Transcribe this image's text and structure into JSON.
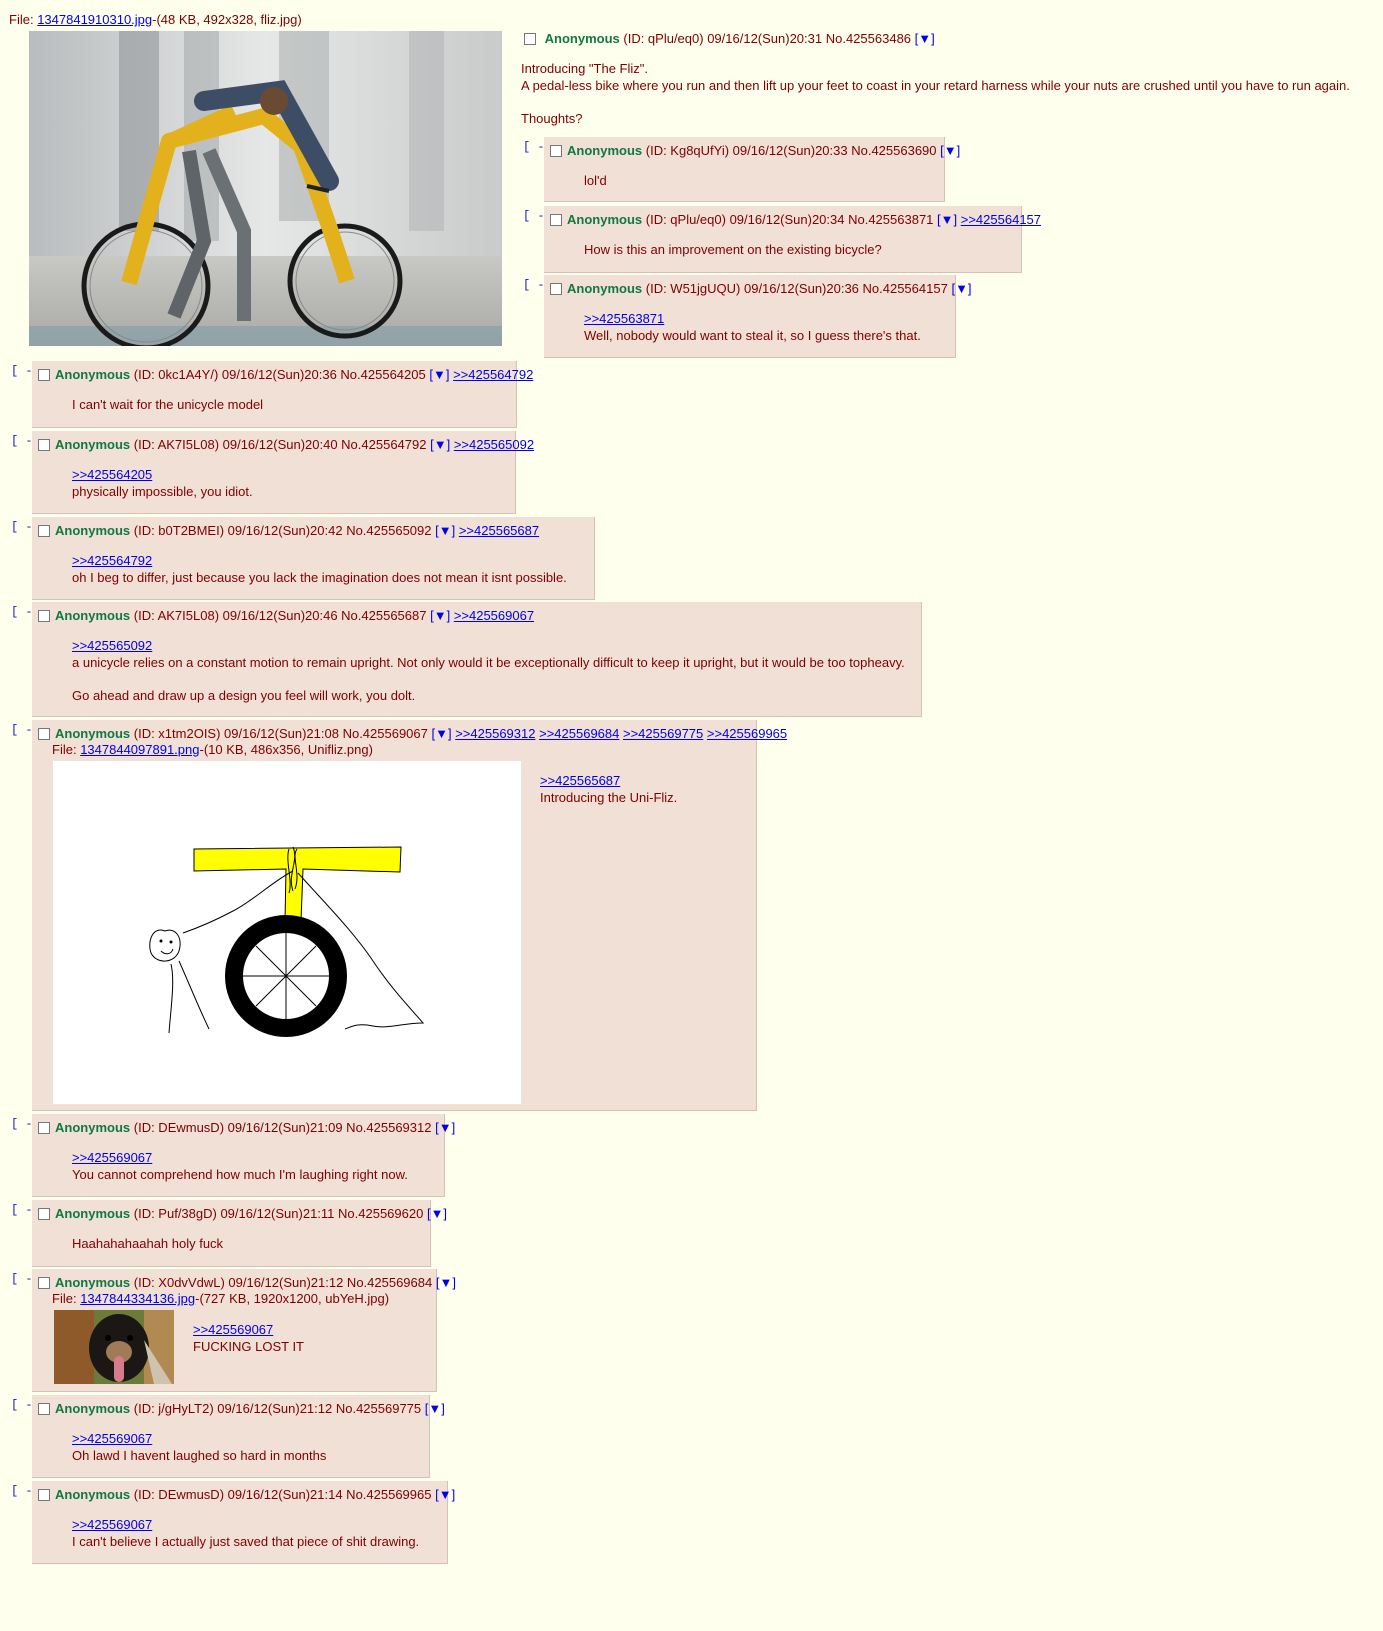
{
  "op": {
    "file_label": "File:",
    "file_link": "1347841910310.jpg",
    "file_meta": "-(48 KB, 492x328, fliz.jpg)",
    "name": "Anonymous",
    "info": "(ID: qPlu/eq0) 09/16/12(Sun)20:31 No.425563486",
    "arrow": "[▼]",
    "lines": [
      "Introducing \"The Fliz\".",
      "A pedal-less bike where you run and then lift up your feet to coast in your retard harness while your nuts are crushed until you have to run again.",
      "",
      "Thoughts?"
    ]
  },
  "collapse_label": "[ - ]",
  "replies": [
    {
      "name": "Anonymous",
      "info": "(ID: Kg8qUfYi) 09/16/12(Sun)20:33 No.425563690",
      "arrow": "[▼]",
      "backlinks": [],
      "quotes": [],
      "lines": [
        "lol'd"
      ]
    },
    {
      "name": "Anonymous",
      "info": "(ID: qPlu/eq0) 09/16/12(Sun)20:34 No.425563871",
      "arrow": "[▼]",
      "backlinks": [
        ">>425564157"
      ],
      "quotes": [],
      "lines": [
        "How is this an improvement on the existing bicycle?"
      ]
    },
    {
      "name": "Anonymous",
      "info": "(ID: W51jgUQU) 09/16/12(Sun)20:36 No.425564157",
      "arrow": "[▼]",
      "backlinks": [],
      "quotes": [
        ">>425563871"
      ],
      "lines": [
        "Well, nobody would want to steal it, so I guess there's that."
      ]
    },
    {
      "name": "Anonymous",
      "info": "(ID: 0kc1A4Y/) 09/16/12(Sun)20:36 No.425564205",
      "arrow": "[▼]",
      "backlinks": [
        ">>425564792"
      ],
      "quotes": [],
      "lines": [
        "I can't wait for the unicycle model"
      ]
    },
    {
      "name": "Anonymous",
      "info": "(ID: AK7I5L08) 09/16/12(Sun)20:40 No.425564792",
      "arrow": "[▼]",
      "backlinks": [
        ">>425565092"
      ],
      "quotes": [
        ">>425564205"
      ],
      "lines": [
        "physically impossible, you idiot."
      ]
    },
    {
      "name": "Anonymous",
      "info": "(ID: b0T2BMEI) 09/16/12(Sun)20:42 No.425565092",
      "arrow": "[▼]",
      "backlinks": [
        ">>425565687"
      ],
      "quotes": [
        ">>425564792"
      ],
      "lines": [
        "oh I beg to differ, just because you lack the imagination does not mean it isnt possible."
      ]
    },
    {
      "name": "Anonymous",
      "info": "(ID: AK7I5L08) 09/16/12(Sun)20:46 No.425565687",
      "arrow": "[▼]",
      "backlinks": [
        ">>425569067"
      ],
      "quotes": [
        ">>425565092"
      ],
      "lines": [
        "a unicycle relies on a constant motion to remain upright. Not only would it be exceptionally difficult to keep it upright, but it would be too topheavy.",
        "",
        "Go ahead and draw up a design you feel will work, you dolt."
      ]
    },
    {
      "name": "Anonymous",
      "info": "(ID: x1tm2OIS) 09/16/12(Sun)21:08 No.425569067",
      "arrow": "[▼]",
      "backlinks": [
        ">>425569312",
        ">>425569684",
        ">>425569775",
        ">>425569965"
      ],
      "file_label": "File:",
      "file_link": "1347844097891.png",
      "file_meta": "-(10 KB, 486x356, Unifliz.png)",
      "quotes": [
        ">>425565687"
      ],
      "lines": [
        "Introducing the Uni-Fliz."
      ]
    },
    {
      "name": "Anonymous",
      "info": "(ID: DEwmusD) 09/16/12(Sun)21:09 No.425569312",
      "arrow": "[▼]",
      "backlinks": [],
      "quotes": [
        ">>425569067"
      ],
      "lines": [
        "You cannot comprehend how much I'm laughing right now."
      ]
    },
    {
      "name": "Anonymous",
      "info": "(ID: Puf/38gD) 09/16/12(Sun)21:11 No.425569620",
      "arrow": "[▼]",
      "backlinks": [],
      "quotes": [],
      "lines": [
        "Haahahahaahah holy fuck"
      ]
    },
    {
      "name": "Anonymous",
      "info": "(ID: X0dvVdwL) 09/16/12(Sun)21:12 No.425569684",
      "arrow": "[▼]",
      "backlinks": [],
      "file_label": "File:",
      "file_link": "1347844334136.jpg",
      "file_meta": "-(727 KB, 1920x1200, ubYeH.jpg)",
      "quotes": [
        ">>425569067"
      ],
      "lines": [
        "FUCKING LOST IT"
      ]
    },
    {
      "name": "Anonymous",
      "info": "(ID: j/gHyLT2) 09/16/12(Sun)21:12 No.425569775",
      "arrow": "[▼]",
      "backlinks": [],
      "quotes": [
        ">>425569067"
      ],
      "lines": [
        "Oh lawd I havent laughed so hard in months"
      ]
    },
    {
      "name": "Anonymous",
      "info": "(ID: DEwmusD) 09/16/12(Sun)21:14 No.425569965",
      "arrow": "[▼]",
      "backlinks": [],
      "quotes": [
        ">>425569067"
      ],
      "lines": [
        "I can't believe I actually just saved that piece of shit drawing."
      ]
    }
  ]
}
